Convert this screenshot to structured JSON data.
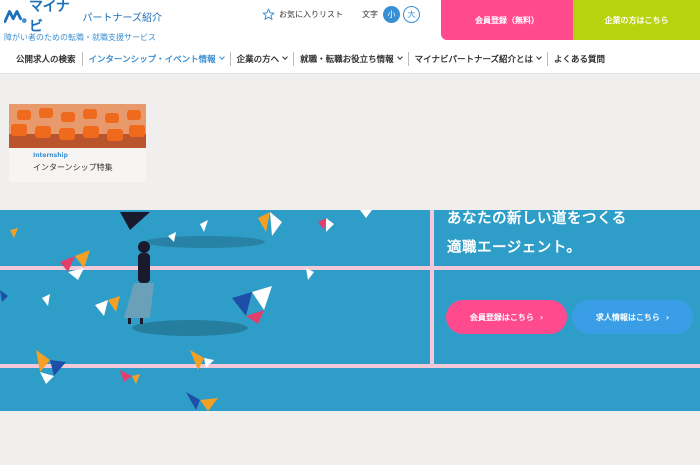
{
  "header": {
    "brand": "マイナビ",
    "brand_sub": "パートナーズ紹介",
    "tagline": "障がい者のための転職・就職支援サービス",
    "favorites_label": "お気に入りリスト",
    "font_size_label": "文字",
    "font_small": "小",
    "font_large": "大",
    "register_label": "会員登録（無料）",
    "company_label": "企業の方はこちら"
  },
  "nav": {
    "items": [
      {
        "label": "公開求人の検索"
      },
      {
        "label": "インターンシップ・イベント情報"
      },
      {
        "label": "企業の方へ"
      },
      {
        "label": "就職・転職お役立ち情報"
      },
      {
        "label": "マイナビパートナーズ紹介とは"
      },
      {
        "label": "よくある質問"
      }
    ]
  },
  "dropdown": {
    "card_en": "Internship",
    "card_ja": "インターンシップ特集"
  },
  "hero": {
    "line1": "あなたの新しい道をつくる",
    "line2": "適職エージェント。",
    "register_button": "会員登録はこちら",
    "jobs_button": "求人情報はこちら",
    "arrow": "›"
  },
  "colors": {
    "brand_blue": "#1d6fb8",
    "accent_blue": "#3a8fd3",
    "pink": "#ff4a8d",
    "green": "#b7d30f",
    "hero_bg": "#2e9dc7"
  }
}
